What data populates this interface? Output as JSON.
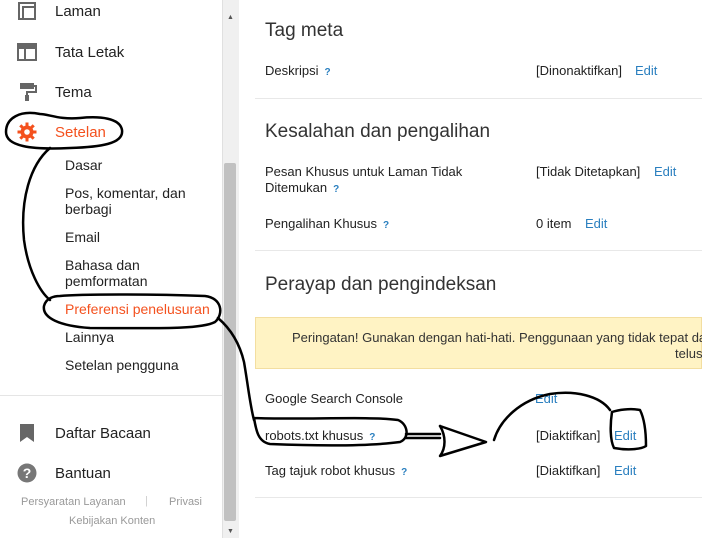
{
  "sidebar": {
    "items": [
      {
        "label": "Laman",
        "icon": "pages-icon"
      },
      {
        "label": "Tata Letak",
        "icon": "layout-icon"
      },
      {
        "label": "Tema",
        "icon": "paint-roller-icon"
      },
      {
        "label": "Setelan",
        "icon": "gear-icon",
        "active": true
      }
    ],
    "sub_items": [
      {
        "label": "Dasar"
      },
      {
        "label": "Pos, komentar, dan berbagi"
      },
      {
        "label": "Email"
      },
      {
        "label": "Bahasa dan pemformatan"
      },
      {
        "label": "Preferensi penelusuran",
        "active": true
      },
      {
        "label": "Lainnya"
      },
      {
        "label": "Setelan pengguna"
      }
    ],
    "bottom_items": [
      {
        "label": "Daftar Bacaan",
        "icon": "bookmark-icon"
      },
      {
        "label": "Bantuan",
        "icon": "help-icon"
      }
    ],
    "footer": {
      "terms": "Persyaratan Layanan",
      "separator": "|",
      "privacy": "Privasi",
      "content_policy": "Kebijakan Konten"
    }
  },
  "main": {
    "meta": {
      "title": "Tag meta",
      "description_label": "Deskripsi",
      "help": "?",
      "description_value": "[Dinonaktifkan]",
      "edit": "Edit"
    },
    "errors": {
      "title": "Kesalahan dan pengalihan",
      "custom_page_label": "Pesan Khusus untuk Laman Tidak Ditemukan",
      "custom_page_value": "[Tidak Ditetapkan]",
      "redirect_label": "Pengalihan Khusus",
      "redirect_value": "0 item",
      "help": "?",
      "edit": "Edit"
    },
    "crawl": {
      "title": "Perayap dan pengindeksan",
      "warning_line1": "Peringatan! Gunakan dengan hati-hati. Penggunaan yang tidak tepat da",
      "warning_line2": "telus",
      "search_console_label": "Google Search Console",
      "robots_label": "robots.txt khusus",
      "robots_value": "[Diaktifkan]",
      "robot_tags_label": "Tag tajuk robot khusus",
      "robot_tags_value": "[Diaktifkan]",
      "help": "?",
      "edit": "Edit"
    }
  },
  "colors": {
    "accent": "#f4511e",
    "link": "#2a7fbf",
    "warning_bg": "#fff3c4"
  }
}
